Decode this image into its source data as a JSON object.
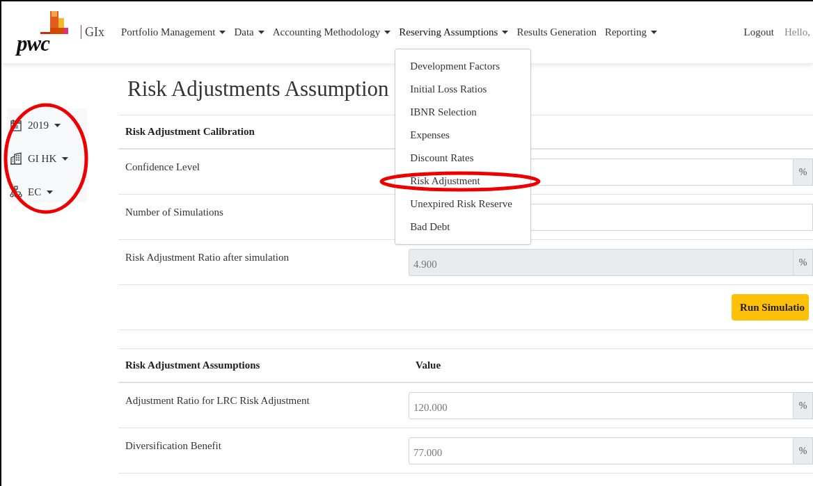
{
  "brand": {
    "logo_text": "pwc",
    "product": "GIx"
  },
  "nav": [
    {
      "label": "Portfolio Management",
      "dropdown": true,
      "expanded": false
    },
    {
      "label": "Data",
      "dropdown": true,
      "expanded": false
    },
    {
      "label": "Accounting Methodology",
      "dropdown": true,
      "expanded": false
    },
    {
      "label": "Reserving Assumptions",
      "dropdown": true,
      "expanded": true,
      "menu": [
        "Development Factors",
        "Initial Loss Ratios",
        "IBNR Selection",
        "Expenses",
        "Discount Rates",
        "Risk Adjustment",
        "Unexpired Risk Reserve",
        "Bad Debt"
      ]
    },
    {
      "label": "Results Generation",
      "dropdown": false,
      "expanded": false
    },
    {
      "label": "Reporting",
      "dropdown": true,
      "expanded": false
    }
  ],
  "user": {
    "logout": "Logout",
    "greeting": "Hello,"
  },
  "sidebar": [
    {
      "kind": "calendar",
      "label": "2019"
    },
    {
      "kind": "building",
      "label": "GI HK"
    },
    {
      "kind": "hierarchy",
      "label": "EC"
    }
  ],
  "title": "Risk Adjustments Assumption",
  "sections": [
    {
      "heading": "Risk Adjustment Calibration",
      "rows": [
        {
          "label": "Confidence Level",
          "unit": "%",
          "disabled": false
        },
        {
          "label": "Number of Simulations",
          "disabled": false
        },
        {
          "label": "Risk Adjustment Ratio after simulation",
          "value": "4.900",
          "unit": "%",
          "disabled": true
        }
      ],
      "button": "Run Simulatio"
    },
    {
      "heading": "Risk Adjustment Assumptions",
      "value_heading": "Value",
      "rows": [
        {
          "label": "Adjustment Ratio for LRC Risk Adjustment",
          "value": "120.000",
          "unit": "%",
          "disabled": false
        },
        {
          "label": "Diversification Benefit",
          "value": "77.000",
          "unit": "%",
          "disabled": false
        }
      ]
    }
  ],
  "annotations": [
    {
      "kind": "ellipse"
    },
    {
      "kind": "ellipse"
    }
  ]
}
